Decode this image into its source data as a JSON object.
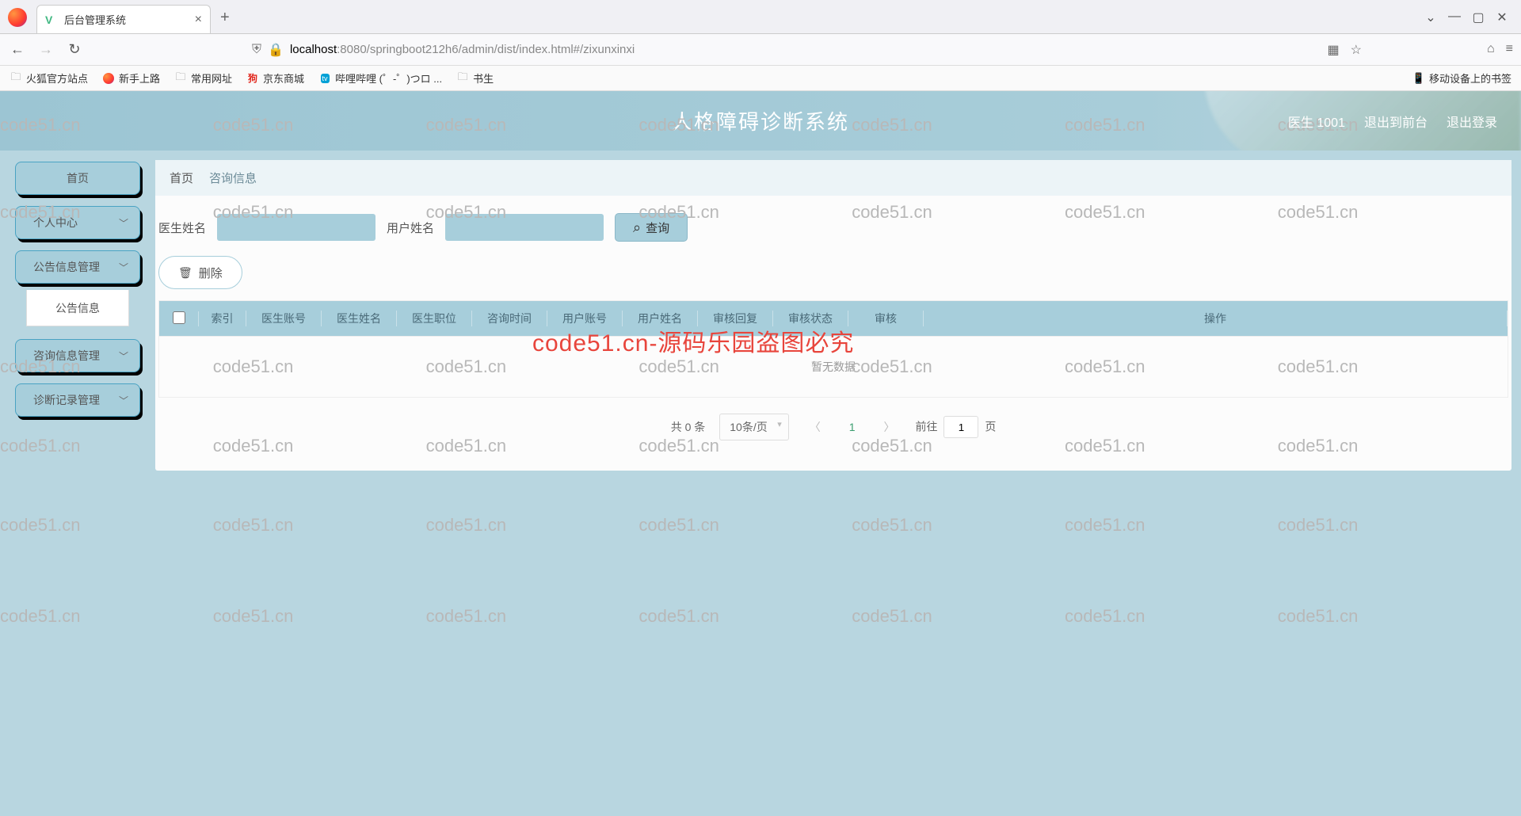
{
  "browser": {
    "tab_title": "后台管理系统",
    "url_host": "localhost",
    "url_port_path": ":8080/springboot212h6/admin/dist/index.html#/zixunxinxi",
    "bookmarks": [
      "火狐官方站点",
      "新手上路",
      "常用网址",
      "京东商城",
      "哔哩哔哩 (゜-゜)つロ ...",
      "书生"
    ],
    "mobile_bookmarks": "移动设备上的书签"
  },
  "header": {
    "title": "人格障碍诊断系统",
    "user_label": "医生 1001",
    "to_front": "退出到前台",
    "logout": "退出登录"
  },
  "sidebar": {
    "items": [
      {
        "label": "首页",
        "expandable": false
      },
      {
        "label": "个人中心",
        "expandable": true
      },
      {
        "label": "公告信息管理",
        "expandable": true,
        "sub": "公告信息"
      },
      {
        "label": "咨询信息管理",
        "expandable": true
      },
      {
        "label": "诊断记录管理",
        "expandable": true
      }
    ]
  },
  "breadcrumb": {
    "home": "首页",
    "current": "咨询信息"
  },
  "filters": {
    "doctor_name_label": "医生姓名",
    "user_name_label": "用户姓名",
    "search_label": "查询"
  },
  "actions": {
    "delete_label": "删除"
  },
  "table": {
    "columns": [
      "索引",
      "医生账号",
      "医生姓名",
      "医生职位",
      "咨询时间",
      "用户账号",
      "用户姓名",
      "审核回复",
      "审核状态",
      "审核",
      "操作"
    ],
    "empty": "暂无数据"
  },
  "pagination": {
    "total_label": "共 0 条",
    "page_size": "10条/页",
    "current": "1",
    "goto_prefix": "前往",
    "goto_value": "1",
    "goto_suffix": "页"
  },
  "watermark": "code51.cn",
  "watermark_red": "code51.cn-源码乐园盗图必究"
}
